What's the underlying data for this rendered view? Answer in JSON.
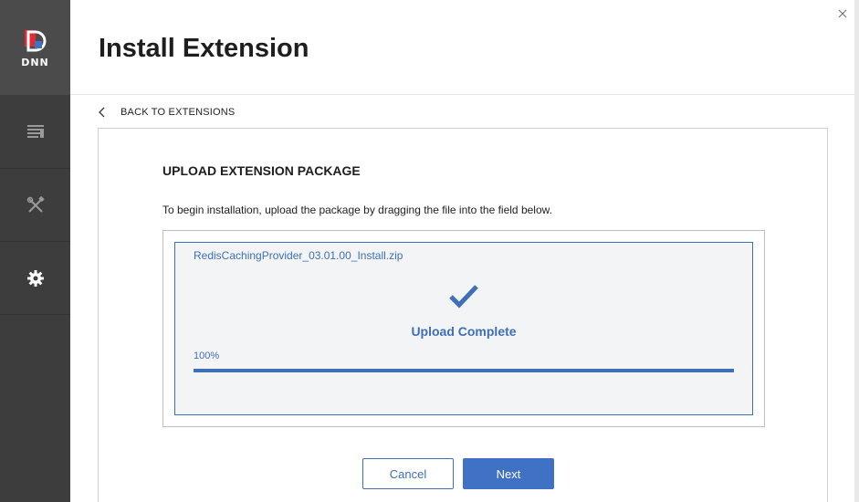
{
  "sidebar": {
    "logo_text": "DNN",
    "items": [
      {
        "icon": "content-icon"
      },
      {
        "icon": "tools-icon"
      },
      {
        "icon": "settings-gear-icon"
      }
    ]
  },
  "header": {
    "title": "Install Extension",
    "close_icon": "close-icon"
  },
  "nav": {
    "back_label": "BACK TO EXTENSIONS"
  },
  "upload": {
    "section_title": "UPLOAD EXTENSION PACKAGE",
    "instructions": "To begin installation, upload the package by dragging the file into the field below.",
    "file_name": "RedisCachingProvider_03.01.00_Install.zip",
    "status": "Upload Complete",
    "progress_label": "100%",
    "progress": 1.0
  },
  "buttons": {
    "cancel": "Cancel",
    "next": "Next"
  },
  "colors": {
    "accent": "#3f6fb6",
    "primary_button": "#3f72c4",
    "sidebar_bg": "#3d3d3d",
    "logo_red": "#e22b36"
  }
}
